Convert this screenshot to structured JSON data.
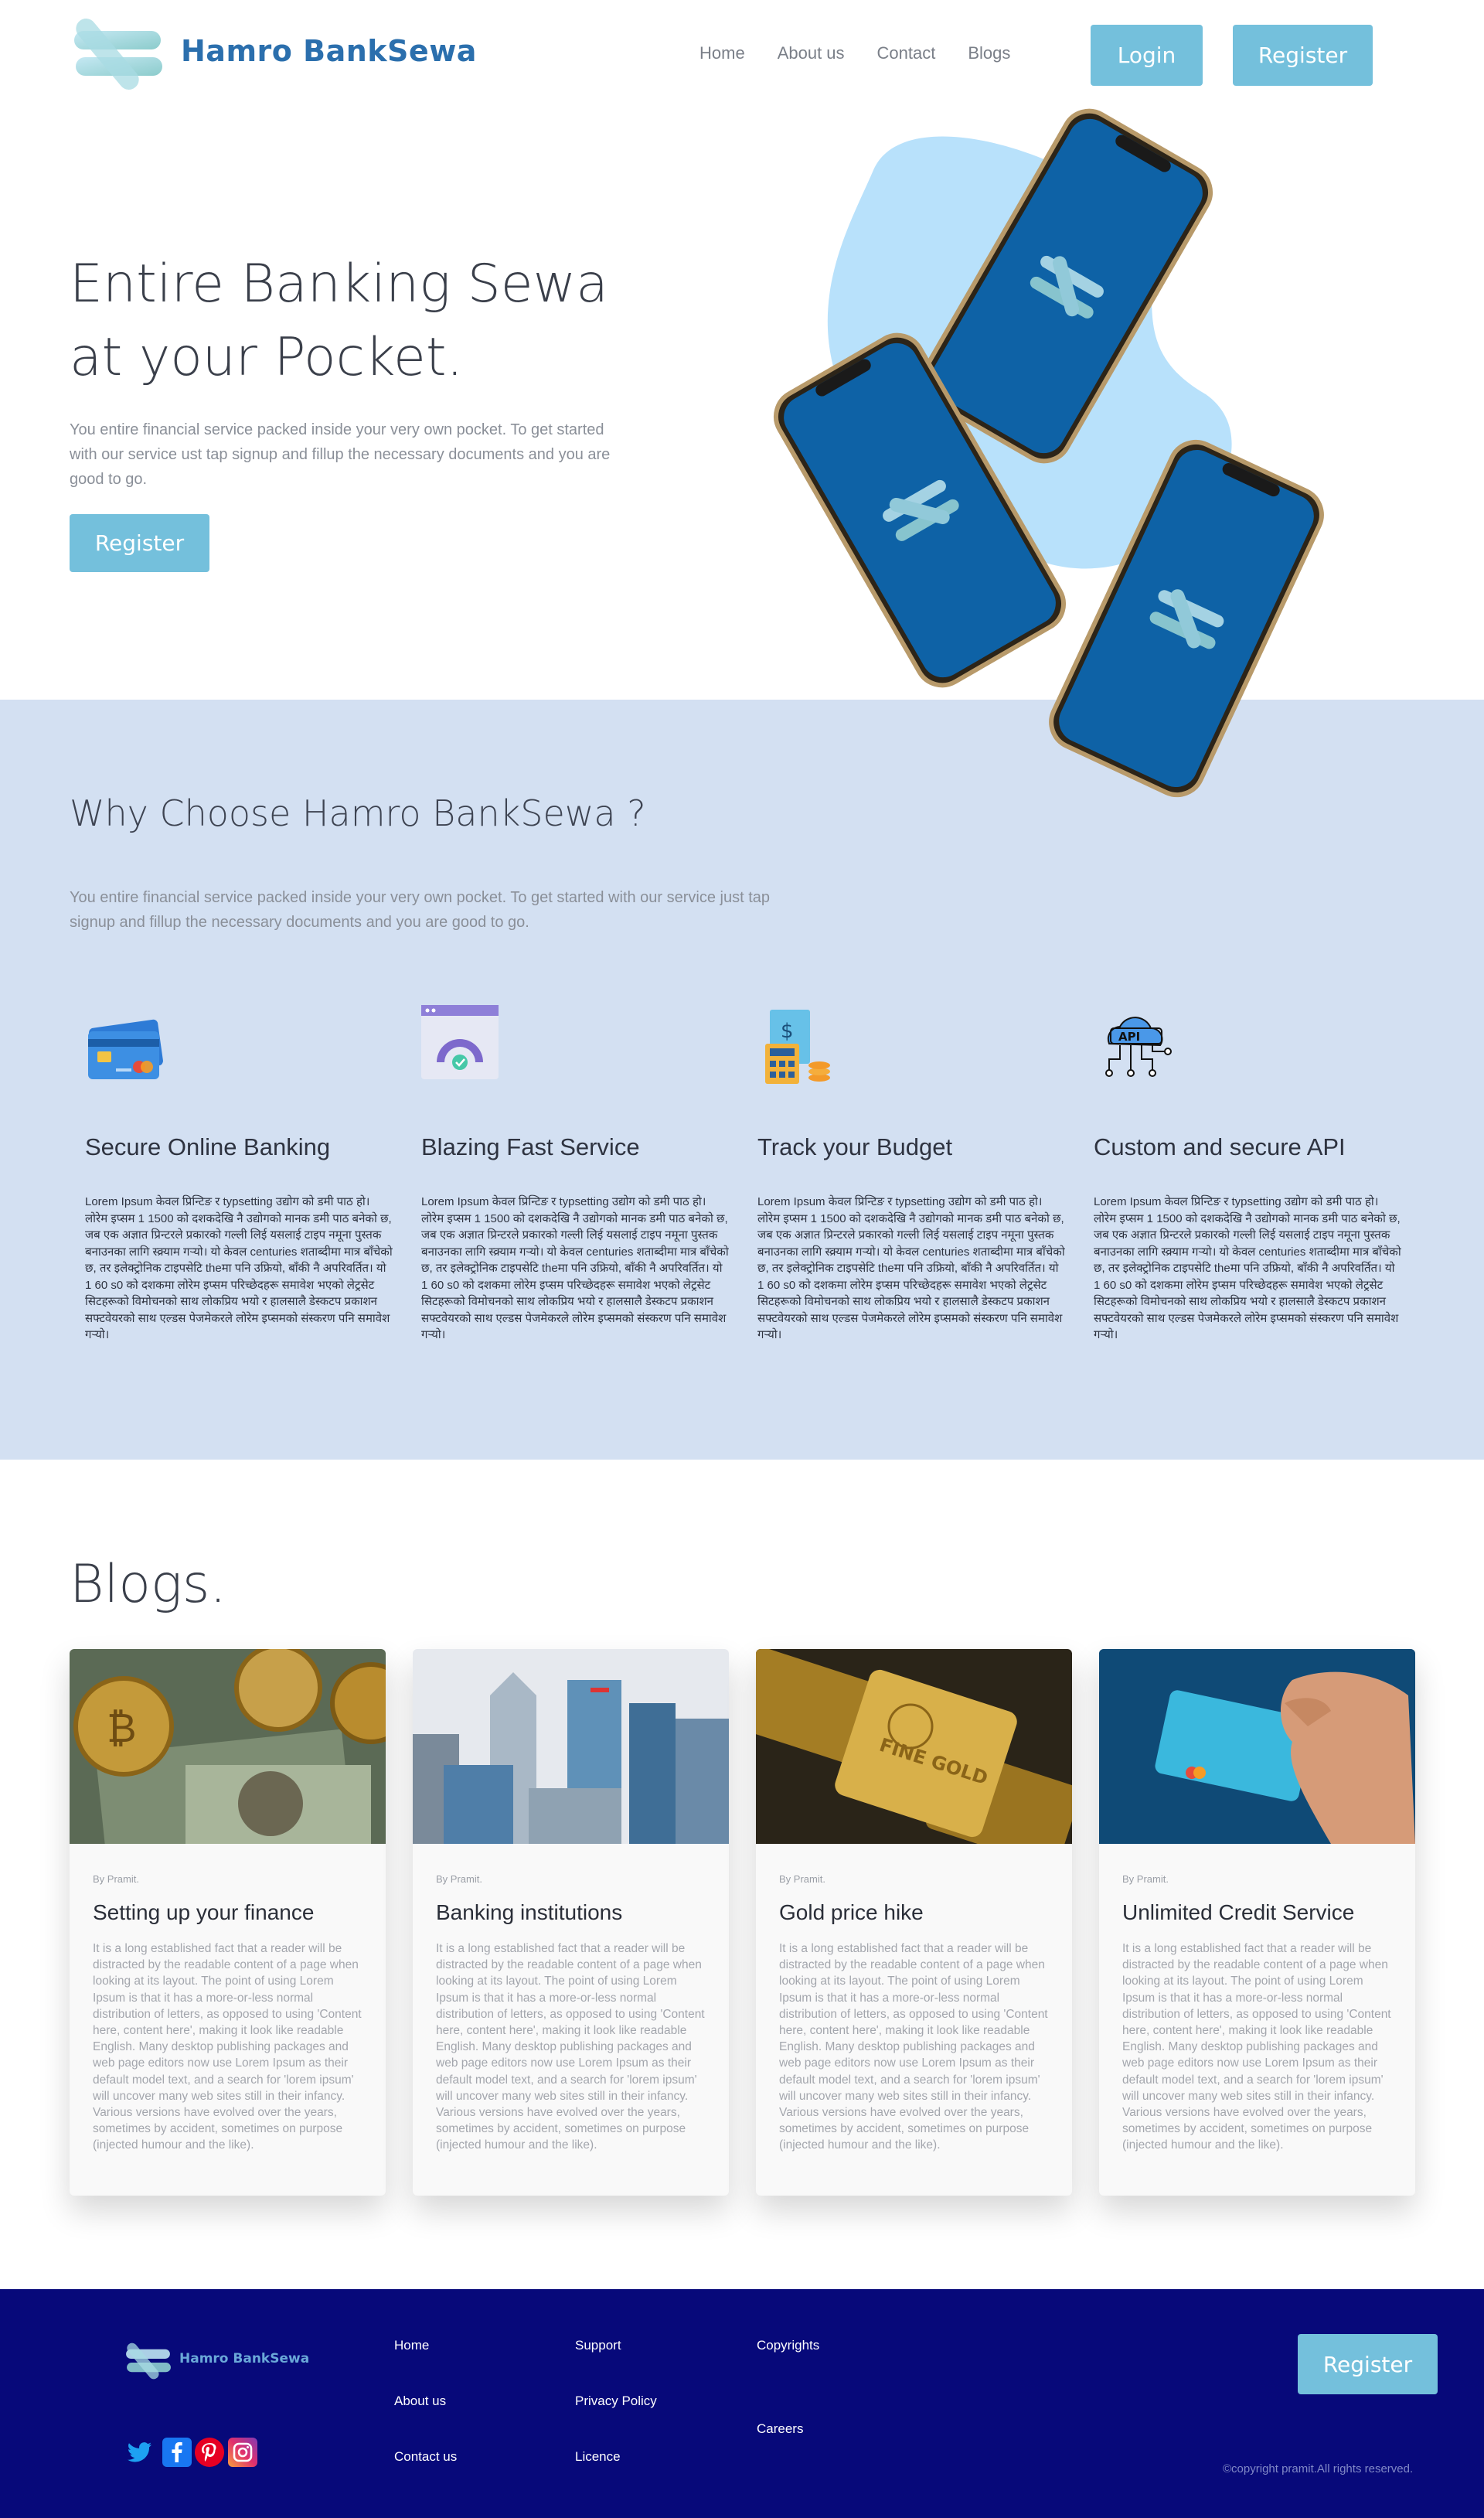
{
  "nav": {
    "brand": "Hamro BankSewa",
    "links": [
      "Home",
      "About us",
      "Contact",
      "Blogs"
    ],
    "login": "Login",
    "register": "Register"
  },
  "hero": {
    "title_line1": "Entire Banking Sewa",
    "title_line2": "at your Pocket.",
    "description": "You entire financial service packed inside your very own pocket. To get started with our service ust tap signup and fillup the necessary documents and you are good to go.",
    "register": "Register"
  },
  "why": {
    "title": "Why Choose Hamro BankSewa ?",
    "description": "You entire financial service packed inside your very own pocket. To get started with our service just tap signup and fillup the necessary documents and you are good to go.",
    "features": [
      {
        "icon": "credit-card-icon",
        "title": "Secure Online Banking",
        "body": "Lorem Ipsum केवल प्रिन्टिङ र typsetting उद्योग को डमी पाठ हो। लोरेम इप्सम 1 1500 को दशकदेखि नै उद्योगको मानक डमी पाठ बनेको छ, जब एक अज्ञात प्रिन्टरले प्रकारको गल्ली लिई यसलाई टाइप नमूना पुस्तक बनाउनका लागि स्क्र्याम गर्‍यो। यो केवल centuries शताब्दीमा मात्र बाँचेको छ, तर इलेक्ट्रोनिक टाइपसेटि theमा पनि उफ्रियो, बाँकी नै अपरिवर्तित। यो 1 60 s0 को दशकमा लोरेम इप्सम परिच्छेदहरू समावेश भएको लेट्रसेट सिटहरूको विमोचनको साथ लोकप्रिय भयो र हालसालै डेस्कटप प्रकाशन सफ्टवेयरको साथ एल्डस पेजमेकरले लोरेम इप्समको संस्करण पनि समावेश गर्‍यो।"
      },
      {
        "icon": "speedometer-icon",
        "title": "Blazing Fast Service",
        "body": "Lorem Ipsum केवल प्रिन्टिङ र typsetting उद्योग को डमी पाठ हो। लोरेम इप्सम 1 1500 को दशकदेखि नै उद्योगको मानक डमी पाठ बनेको छ, जब एक अज्ञात प्रिन्टरले प्रकारको गल्ली लिई यसलाई टाइप नमूना पुस्तक बनाउनका लागि स्क्र्याम गर्‍यो। यो केवल centuries शताब्दीमा मात्र बाँचेको छ, तर इलेक्ट्रोनिक टाइपसेटि theमा पनि उफ्रियो, बाँकी नै अपरिवर्तित। यो 1 60 s0 को दशकमा लोरेम इप्सम परिच्छेदहरू समावेश भएको लेट्रसेट सिटहरूको विमोचनको साथ लोकप्रिय भयो र हालसालै डेस्कटप प्रकाशन सफ्टवेयरको साथ एल्डस पेजमेकरले लोरेम इप्समको संस्करण पनि समावेश गर्‍यो।"
      },
      {
        "icon": "budget-calculator-icon",
        "title": "Track your Budget",
        "body": "Lorem Ipsum केवल प्रिन्टिङ र typsetting उद्योग को डमी पाठ हो। लोरेम इप्सम 1 1500 को दशकदेखि नै उद्योगको मानक डमी पाठ बनेको छ, जब एक अज्ञात प्रिन्टरले प्रकारको गल्ली लिई यसलाई टाइप नमूना पुस्तक बनाउनका लागि स्क्र्याम गर्‍यो। यो केवल centuries शताब्दीमा मात्र बाँचेको छ, तर इलेक्ट्रोनिक टाइपसेटि theमा पनि उफ्रियो, बाँकी नै अपरिवर्तित। यो 1 60 s0 को दशकमा लोरेम इप्सम परिच्छेदहरू समावेश भएको लेट्रसेट सिटहरूको विमोचनको साथ लोकप्रिय भयो र हालसालै डेस्कटप प्रकाशन सफ्टवेयरको साथ एल्डस पेजमेकरले लोरेम इप्समको संस्करण पनि समावेश गर्‍यो।"
      },
      {
        "icon": "cloud-api-icon",
        "title": "Custom and secure API",
        "body": "Lorem Ipsum केवल प्रिन्टिङ र typsetting उद्योग को डमी पाठ हो। लोरेम इप्सम 1 1500 को दशकदेखि नै उद्योगको मानक डमी पाठ बनेको छ, जब एक अज्ञात प्रिन्टरले प्रकारको गल्ली लिई यसलाई टाइप नमूना पुस्तक बनाउनका लागि स्क्र्याम गर्‍यो। यो केवल centuries शताब्दीमा मात्र बाँचेको छ, तर इलेक्ट्रोनिक टाइपसेटि theमा पनि उफ्रियो, बाँकी नै अपरिवर्तित। यो 1 60 s0 को दशकमा लोरेम इप्सम परिच्छेदहरू समावेश भएको लेट्रसेट सिटहरूको विमोचनको साथ लोकप्रिय भयो र हालसालै डेस्कटप प्रकाशन सफ्टवेयरको साथ एल्डस पेजमेकरले लोरेम इप्समको संस्करण पनि समावेश गर्‍यो।"
      }
    ],
    "api_icon_label": "API"
  },
  "blogs": {
    "title": "Blogs.",
    "posts": [
      {
        "image": "bitcoin-cash-image",
        "author": "By Pramit.",
        "title": "Setting up your finance",
        "body": "It is a long established fact that a reader will be distracted by the readable content of a page when looking at its layout. The point of using Lorem Ipsum is that it has a more-or-less normal distribution of letters, as opposed to using 'Content here, content here', making it look like readable English. Many desktop publishing packages and web page editors now use Lorem Ipsum as their default model text, and a search for 'lorem ipsum' will uncover many web sites still in their infancy. Various versions have evolved over the years, sometimes by accident, sometimes on purpose (injected humour and the like)."
      },
      {
        "image": "skyscrapers-image",
        "author": "By Pramit.",
        "title": "Banking institutions",
        "body": "It is a long established fact that a reader will be distracted by the readable content of a page when looking at its layout. The point of using Lorem Ipsum is that it has a more-or-less normal distribution of letters, as opposed to using 'Content here, content here', making it look like readable English. Many desktop publishing packages and web page editors now use Lorem Ipsum as their default model text, and a search for 'lorem ipsum' will uncover many web sites still in their infancy. Various versions have evolved over the years, sometimes by accident, sometimes on purpose (injected humour and the like)."
      },
      {
        "image": "gold-bars-image",
        "author": "By Pramit.",
        "title": "Gold price hike",
        "body": "It is a long established fact that a reader will be distracted by the readable content of a page when looking at its layout. The point of using Lorem Ipsum is that it has a more-or-less normal distribution of letters, as opposed to using 'Content here, content here', making it look like readable English. Many desktop publishing packages and web page editors now use Lorem Ipsum as their default model text, and a search for 'lorem ipsum' will uncover many web sites still in their infancy. Various versions have evolved over the years, sometimes by accident, sometimes on purpose (injected humour and the like)."
      },
      {
        "image": "credit-card-hand-image",
        "author": "By Pramit.",
        "title": "Unlimited Credit Service",
        "body": "It is a long established fact that a reader will be distracted by the readable content of a page when looking at its layout. The point of using Lorem Ipsum is that it has a more-or-less normal distribution of letters, as opposed to using 'Content here, content here', making it look like readable English. Many desktop publishing packages and web page editors now use Lorem Ipsum as their default model text, and a search for 'lorem ipsum' will uncover many web sites still in their infancy. Various versions have evolved over the years, sometimes by accident, sometimes on purpose (injected humour and the like)."
      }
    ],
    "gold_bar_text": "FINE GOLD"
  },
  "footer": {
    "brand": "Hamro BankSewa",
    "col1": [
      "Home",
      "About us",
      "Contact us"
    ],
    "col2": [
      "Support",
      "Privacy Policy",
      "Licence"
    ],
    "col3": [
      "Copyrights",
      "Careers"
    ],
    "register": "Register",
    "copyright": "©copyright pramit.All rights reserved.",
    "social": [
      "twitter-icon",
      "facebook-icon",
      "pinterest-icon",
      "instagram-icon"
    ]
  },
  "colors": {
    "accent": "#74c0dc",
    "brand": "#2b6fad",
    "why_bg": "#d3e0f2",
    "footer_bg": "#07097a",
    "phone_screen": "#0e62a6",
    "blob": "#b8e1fb"
  }
}
